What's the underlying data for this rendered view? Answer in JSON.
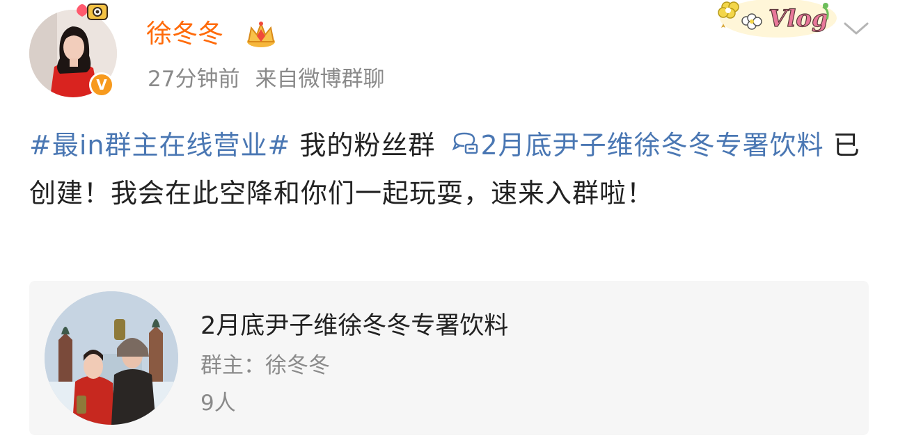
{
  "post_header": {
    "username": "徐冬冬",
    "time": "27分钟前",
    "source": "来自微博群聊",
    "verify_badge": "V"
  },
  "post_body": {
    "topic": "#最in群主在线营业#",
    "text_1": " 我的粉丝群 ",
    "group_link": "2月底尹子维徐冬冬专署饮料",
    "text_2": " 已创建！我会在此空降和你们一起玩耍，速来入群啦！"
  },
  "group_card": {
    "title": "2月底尹子维徐冬冬专署饮料",
    "owner": "群主：徐冬冬",
    "members": "9人"
  },
  "icons": {
    "crown": "crown-vip-icon",
    "vlog": "vlog-sticker",
    "chevron": "chevron-down-icon",
    "group": "group-chat-icon"
  },
  "colors": {
    "username": "#ff6b0a",
    "link": "#4a77b3",
    "meta": "#8a8a8a",
    "badge": "#f79a1e",
    "card_bg": "#f6f6f6"
  }
}
